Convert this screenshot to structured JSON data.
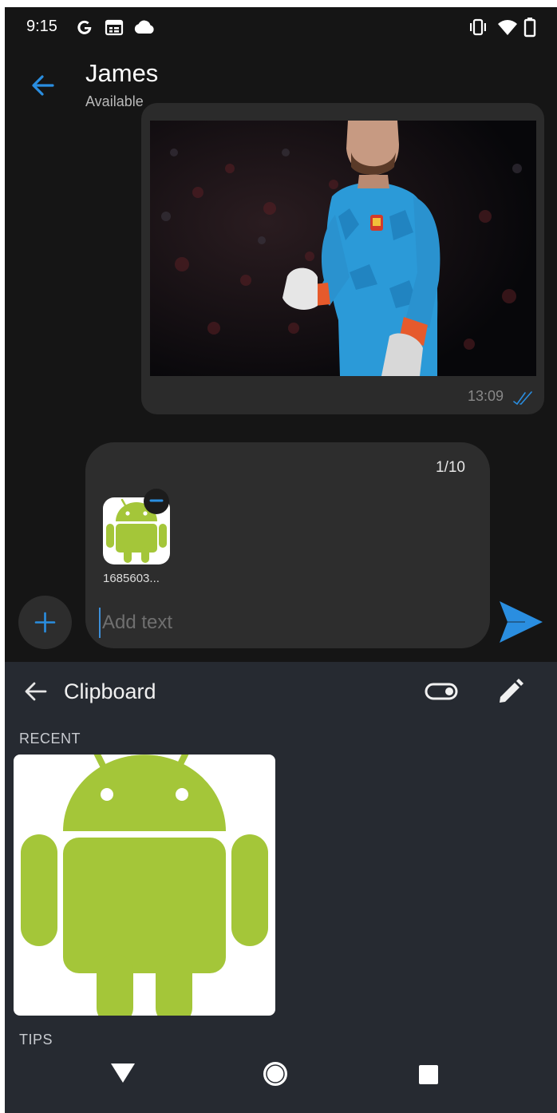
{
  "status_bar": {
    "time": "9:15",
    "icons": [
      "google-g-icon",
      "calendar-icon",
      "cloud-icon",
      "vibrate-icon",
      "wifi-icon",
      "battery-icon"
    ]
  },
  "header": {
    "name": "James",
    "status": "Available"
  },
  "message": {
    "time": "13:09",
    "status": "read"
  },
  "compose": {
    "attachment_count": "1/10",
    "attachment_name": "1685603...",
    "placeholder": "Add text"
  },
  "clipboard": {
    "title": "Clipboard",
    "recent_label": "RECENT",
    "tips_label": "TIPS"
  },
  "colors": {
    "accent": "#2a8ee0",
    "android_green": "#a4c639",
    "panel_bg": "#262a31"
  }
}
